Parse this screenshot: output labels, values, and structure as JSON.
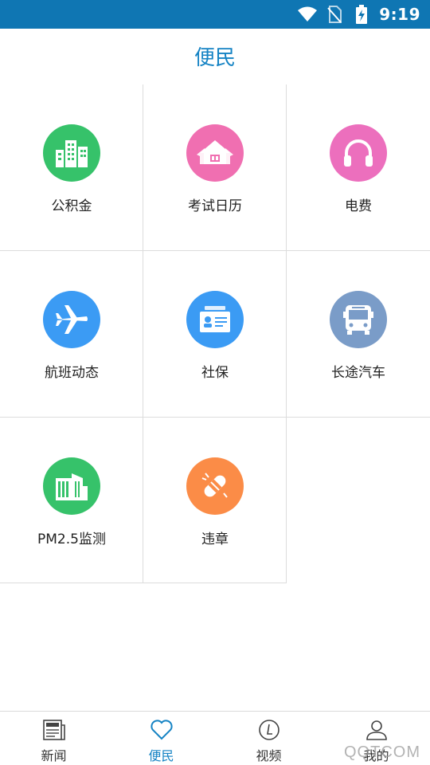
{
  "status_bar": {
    "time": "9:19",
    "icons": [
      "wifi-icon",
      "no-sim-icon",
      "battery-charging-icon"
    ]
  },
  "header": {
    "title": "便民"
  },
  "colors": {
    "accent": "#1583c4",
    "status_bar": "#0f76b3",
    "green": "#36c26a",
    "pink": "#f06fb1",
    "blue": "#3b9bf4",
    "steel": "#7a9cc8",
    "orange": "#fb8c47"
  },
  "services": [
    {
      "label": "公积金",
      "icon": "buildings-icon",
      "color": "#36c26a"
    },
    {
      "label": "考试日历",
      "icon": "house-calendar-icon",
      "color": "#f06fb1"
    },
    {
      "label": "电费",
      "icon": "headphones-icon",
      "color": "#ec6fbd"
    },
    {
      "label": "航班动态",
      "icon": "airplane-icon",
      "color": "#3b9bf4"
    },
    {
      "label": "社保",
      "icon": "id-card-icon",
      "color": "#3b9bf4"
    },
    {
      "label": "长途汽车",
      "icon": "bus-icon",
      "color": "#7a9cc8"
    },
    {
      "label": "PM2.5监测",
      "icon": "office-building-icon",
      "color": "#36c26a"
    },
    {
      "label": "违章",
      "icon": "bandage-icon",
      "color": "#fb8c47"
    }
  ],
  "bottom_nav": [
    {
      "label": "新闻",
      "icon": "newspaper-icon",
      "active": false
    },
    {
      "label": "便民",
      "icon": "heart-icon",
      "active": true
    },
    {
      "label": "视频",
      "icon": "play-circle-icon",
      "active": false
    },
    {
      "label": "我的",
      "icon": "user-icon",
      "active": false
    }
  ],
  "watermark": "QQTCOM"
}
